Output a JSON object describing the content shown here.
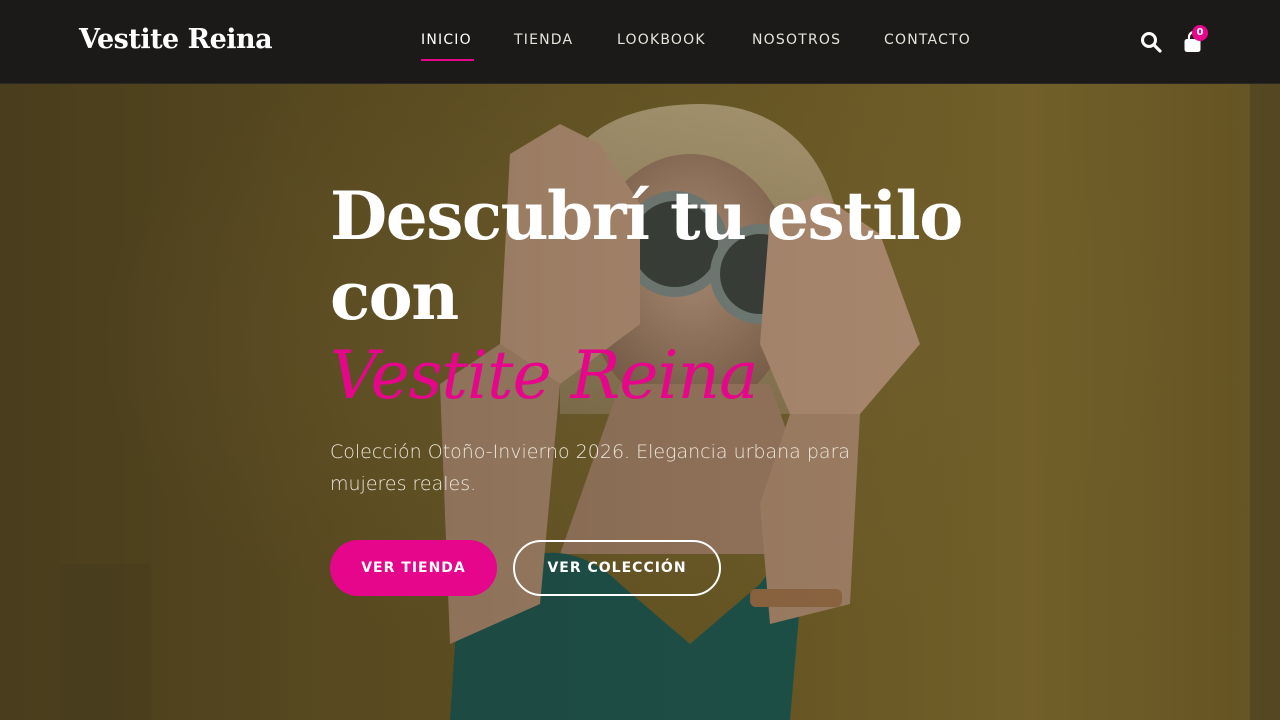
{
  "brand": {
    "name": "Vestite Reina",
    "accent_color": "#e5068b"
  },
  "nav": {
    "items": [
      {
        "label": "INICIO",
        "active": true
      },
      {
        "label": "TIENDA",
        "active": false
      },
      {
        "label": "LOOKBOOK",
        "active": false
      },
      {
        "label": "NOSOTROS",
        "active": false
      },
      {
        "label": "CONTACTO",
        "active": false
      }
    ]
  },
  "header_actions": {
    "search_icon": "search-icon",
    "cart_icon": "shopping-bag-icon",
    "cart_count": "0"
  },
  "hero": {
    "title_line1": "Descubrí tu estilo",
    "title_line2": "con",
    "title_accent": "Vestite Reina",
    "subtitle": "Colección Otoño-Invierno 2026. Elegancia urbana para mujeres reales.",
    "primary_button": "VER TIENDA",
    "secondary_button": "VER COLECCIÓN"
  }
}
